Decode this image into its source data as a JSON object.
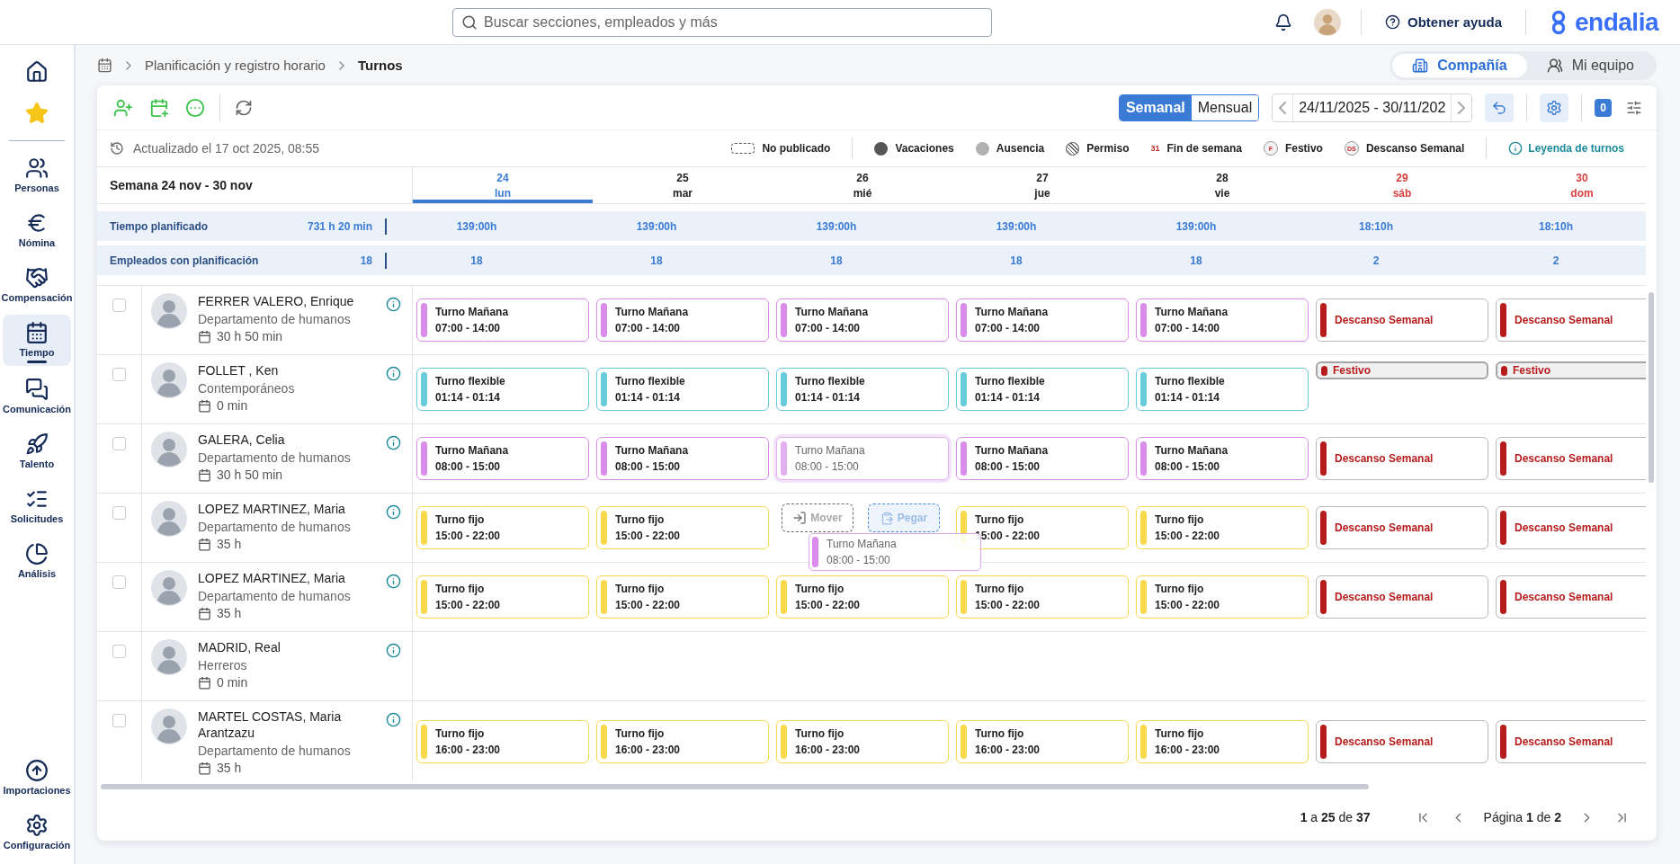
{
  "top_bar": {
    "search": {
      "placeholder": "Buscar secciones, empleados y más"
    },
    "help": "Obtener ayuda",
    "logo": "endalia"
  },
  "sidebar": {
    "items": [
      {
        "selected": false
      },
      {
        "selected": false
      },
      {
        "label": "Personas",
        "selected": false
      },
      {
        "label": "Nómina",
        "selected": false
      },
      {
        "label": "Compensación",
        "selected": false
      },
      {
        "label": "Tiempo",
        "selected": true
      },
      {
        "label": "Comunicación",
        "selected": false
      },
      {
        "label": "Talento",
        "selected": false
      },
      {
        "label": "Solicitudes",
        "selected": false
      },
      {
        "label": "Análisis",
        "selected": false
      }
    ],
    "bottom_items": [
      {
        "label": "Importaciones",
        "selected": false
      },
      {
        "label": "Configuración",
        "selected": false
      }
    ]
  },
  "breadcrumb": [
    "Planificación y registro horario",
    "Turnos"
  ],
  "scope_switch": [
    {
      "label": "Compañía",
      "selected": true
    },
    {
      "label": "Mi equipo",
      "selected": false
    }
  ],
  "toolbar": {
    "view_modes": [
      {
        "label": "Semanal",
        "selected": true
      },
      {
        "label": "Mensual",
        "selected": false
      }
    ],
    "date_range": "24/11/2025 - 30/11/202",
    "filter_count": "0"
  },
  "status": {
    "updated": "Actualizado el 17 oct 2025, 08:55",
    "legend": [
      {
        "kind": "dashed",
        "label": "No publicado"
      },
      {
        "kind": "dot",
        "color": "#555555",
        "label": "Vacaciones"
      },
      {
        "kind": "dot",
        "color": "#b0b0b0",
        "label": "Ausencia"
      },
      {
        "kind": "hatched",
        "label": "Permiso"
      },
      {
        "kind": "text",
        "mark": "31",
        "label": "Fin de semana"
      },
      {
        "kind": "circle",
        "mark": "F",
        "label": "Festivo"
      },
      {
        "kind": "circle",
        "mark": "DS",
        "label": "Descanso Semanal"
      }
    ],
    "legend_link": "Leyenda de turnos"
  },
  "schedule": {
    "week_label": "Semana 24 nov - 30 nov",
    "days": [
      {
        "number": "24",
        "name": "lun",
        "selected": true,
        "weekend": false
      },
      {
        "number": "25",
        "name": "mar",
        "selected": false,
        "weekend": false
      },
      {
        "number": "26",
        "name": "mié",
        "selected": false,
        "weekend": false
      },
      {
        "number": "27",
        "name": "jue",
        "selected": false,
        "weekend": false
      },
      {
        "number": "28",
        "name": "vie",
        "selected": false,
        "weekend": false
      },
      {
        "number": "29",
        "name": "sáb",
        "selected": false,
        "weekend": true
      },
      {
        "number": "30",
        "name": "dom",
        "selected": false,
        "weekend": true
      }
    ],
    "summary": [
      {
        "label": "Tiempo planificado",
        "total": "731 h 20 min",
        "values": [
          "139:00h",
          "139:00h",
          "139:00h",
          "139:00h",
          "139:00h",
          "18:10h",
          "18:10h"
        ]
      },
      {
        "label": "Empleados con planificación",
        "total": "18",
        "values": [
          "18",
          "18",
          "18",
          "18",
          "18",
          "2",
          "2"
        ]
      }
    ],
    "employees": [
      {
        "name": "FERRER VALERO, Enrique",
        "department": "Departamento de humanos",
        "hours": "30 h 50 min",
        "checked": false,
        "shifts": [
          {
            "kind": "shift",
            "title": "Turno Mañana",
            "time": "07:00 - 14:00",
            "color": "#d98ce9"
          },
          {
            "kind": "shift",
            "title": "Turno Mañana",
            "time": "07:00 - 14:00",
            "color": "#d98ce9"
          },
          {
            "kind": "shift",
            "title": "Turno Mañana",
            "time": "07:00 - 14:00",
            "color": "#d98ce9"
          },
          {
            "kind": "shift",
            "title": "Turno Mañana",
            "time": "07:00 - 14:00",
            "color": "#d98ce9"
          },
          {
            "kind": "shift",
            "title": "Turno Mañana",
            "time": "07:00 - 14:00",
            "color": "#d98ce9"
          },
          {
            "kind": "rest",
            "title": "Descanso Semanal"
          },
          {
            "kind": "rest",
            "title": "Descanso Semanal"
          }
        ]
      },
      {
        "name": "FOLLET , Ken",
        "department": "Contemporáneos",
        "hours": "0 min",
        "checked": false,
        "shifts": [
          {
            "kind": "shift",
            "title": "Turno flexible",
            "time": "01:14 - 01:14",
            "color": "#66cbdb"
          },
          {
            "kind": "shift",
            "title": "Turno flexible",
            "time": "01:14 - 01:14",
            "color": "#66cbdb"
          },
          {
            "kind": "shift",
            "title": "Turno flexible",
            "time": "01:14 - 01:14",
            "color": "#66cbdb"
          },
          {
            "kind": "shift",
            "title": "Turno flexible",
            "time": "01:14 - 01:14",
            "color": "#66cbdb"
          },
          {
            "kind": "shift",
            "title": "Turno flexible",
            "time": "01:14 - 01:14",
            "color": "#66cbdb"
          },
          {
            "kind": "holiday",
            "title": "Festivo"
          },
          {
            "kind": "holiday",
            "title": "Festivo"
          }
        ]
      },
      {
        "name": "GALERA, Celia",
        "department": "Departamento de humanos",
        "hours": "30 h 50 min",
        "checked": false,
        "shifts": [
          {
            "kind": "shift",
            "title": "Turno Mañana",
            "time": "08:00 - 15:00",
            "color": "#d98ce9"
          },
          {
            "kind": "shift",
            "title": "Turno Mañana",
            "time": "08:00 - 15:00",
            "color": "#d98ce9"
          },
          {
            "kind": "dragged",
            "title": "Turno Mañana",
            "time": "08:00 - 15:00",
            "color": "#e2b0ef"
          },
          {
            "kind": "shift",
            "title": "Turno Mañana",
            "time": "08:00 - 15:00",
            "color": "#d98ce9"
          },
          {
            "kind": "shift",
            "title": "Turno Mañana",
            "time": "08:00 - 15:00",
            "color": "#d98ce9"
          },
          {
            "kind": "rest",
            "title": "Descanso Semanal"
          },
          {
            "kind": "rest",
            "title": "Descanso Semanal"
          }
        ]
      },
      {
        "name": "LOPEZ MARTINEZ, Maria",
        "department": "Departamento de humanos",
        "hours": "35 h",
        "checked": false,
        "shifts": [
          {
            "kind": "shift",
            "title": "Turno fijo",
            "time": "15:00 - 22:00",
            "color": "#f8d94c"
          },
          {
            "kind": "shift",
            "title": "Turno fijo",
            "time": "15:00 - 22:00",
            "color": "#f8d94c"
          },
          {
            "kind": "drop",
            "actions": [
              "Mover",
              "Pegar"
            ],
            "ghost": {
              "title": "Turno Mañana",
              "time": "08:00 - 15:00",
              "color": "#d98ce9"
            }
          },
          {
            "kind": "shift",
            "title": "Turno fijo",
            "time": "15:00 - 22:00",
            "color": "#f8d94c"
          },
          {
            "kind": "shift",
            "title": "Turno fijo",
            "time": "15:00 - 22:00",
            "color": "#f8d94c"
          },
          {
            "kind": "rest",
            "title": "Descanso Semanal"
          },
          {
            "kind": "rest",
            "title": "Descanso Semanal"
          }
        ]
      },
      {
        "name": "LOPEZ MARTINEZ, Maria",
        "department": "Departamento de humanos",
        "hours": "35 h",
        "checked": false,
        "shifts": [
          {
            "kind": "shift",
            "title": "Turno fijo",
            "time": "15:00 - 22:00",
            "color": "#f8d94c"
          },
          {
            "kind": "shift",
            "title": "Turno fijo",
            "time": "15:00 - 22:00",
            "color": "#f8d94c"
          },
          {
            "kind": "shift",
            "title": "Turno fijo",
            "time": "15:00 - 22:00",
            "color": "#f8d94c"
          },
          {
            "kind": "shift",
            "title": "Turno fijo",
            "time": "15:00 - 22:00",
            "color": "#f8d94c"
          },
          {
            "kind": "shift",
            "title": "Turno fijo",
            "time": "15:00 - 22:00",
            "color": "#f8d94c"
          },
          {
            "kind": "rest",
            "title": "Descanso Semanal"
          },
          {
            "kind": "rest",
            "title": "Descanso Semanal"
          }
        ]
      },
      {
        "name": "MADRID, Real",
        "department": "Herreros",
        "hours": "0 min",
        "checked": false
      },
      {
        "name": "MARTEL COSTAS, Maria Arantzazu",
        "department": "Departamento de humanos",
        "hours": "35 h",
        "checked": false,
        "shifts": [
          {
            "kind": "shift",
            "title": "Turno fijo",
            "time": "16:00 - 23:00",
            "color": "#f8d94c"
          },
          {
            "kind": "shift",
            "title": "Turno fijo",
            "time": "16:00 - 23:00",
            "color": "#f8d94c"
          },
          {
            "kind": "shift",
            "title": "Turno fijo",
            "time": "16:00 - 23:00",
            "color": "#f8d94c"
          },
          {
            "kind": "shift",
            "title": "Turno fijo",
            "time": "16:00 - 23:00",
            "color": "#f8d94c"
          },
          {
            "kind": "shift",
            "title": "Turno fijo",
            "time": "16:00 - 23:00",
            "color": "#f8d94c"
          },
          {
            "kind": "rest",
            "title": "Descanso Semanal"
          },
          {
            "kind": "rest",
            "title": "Descanso Semanal"
          }
        ]
      }
    ]
  },
  "pagination": {
    "range": "**1** a **25** de **37**",
    "page": "Página **1** de **2**"
  }
}
